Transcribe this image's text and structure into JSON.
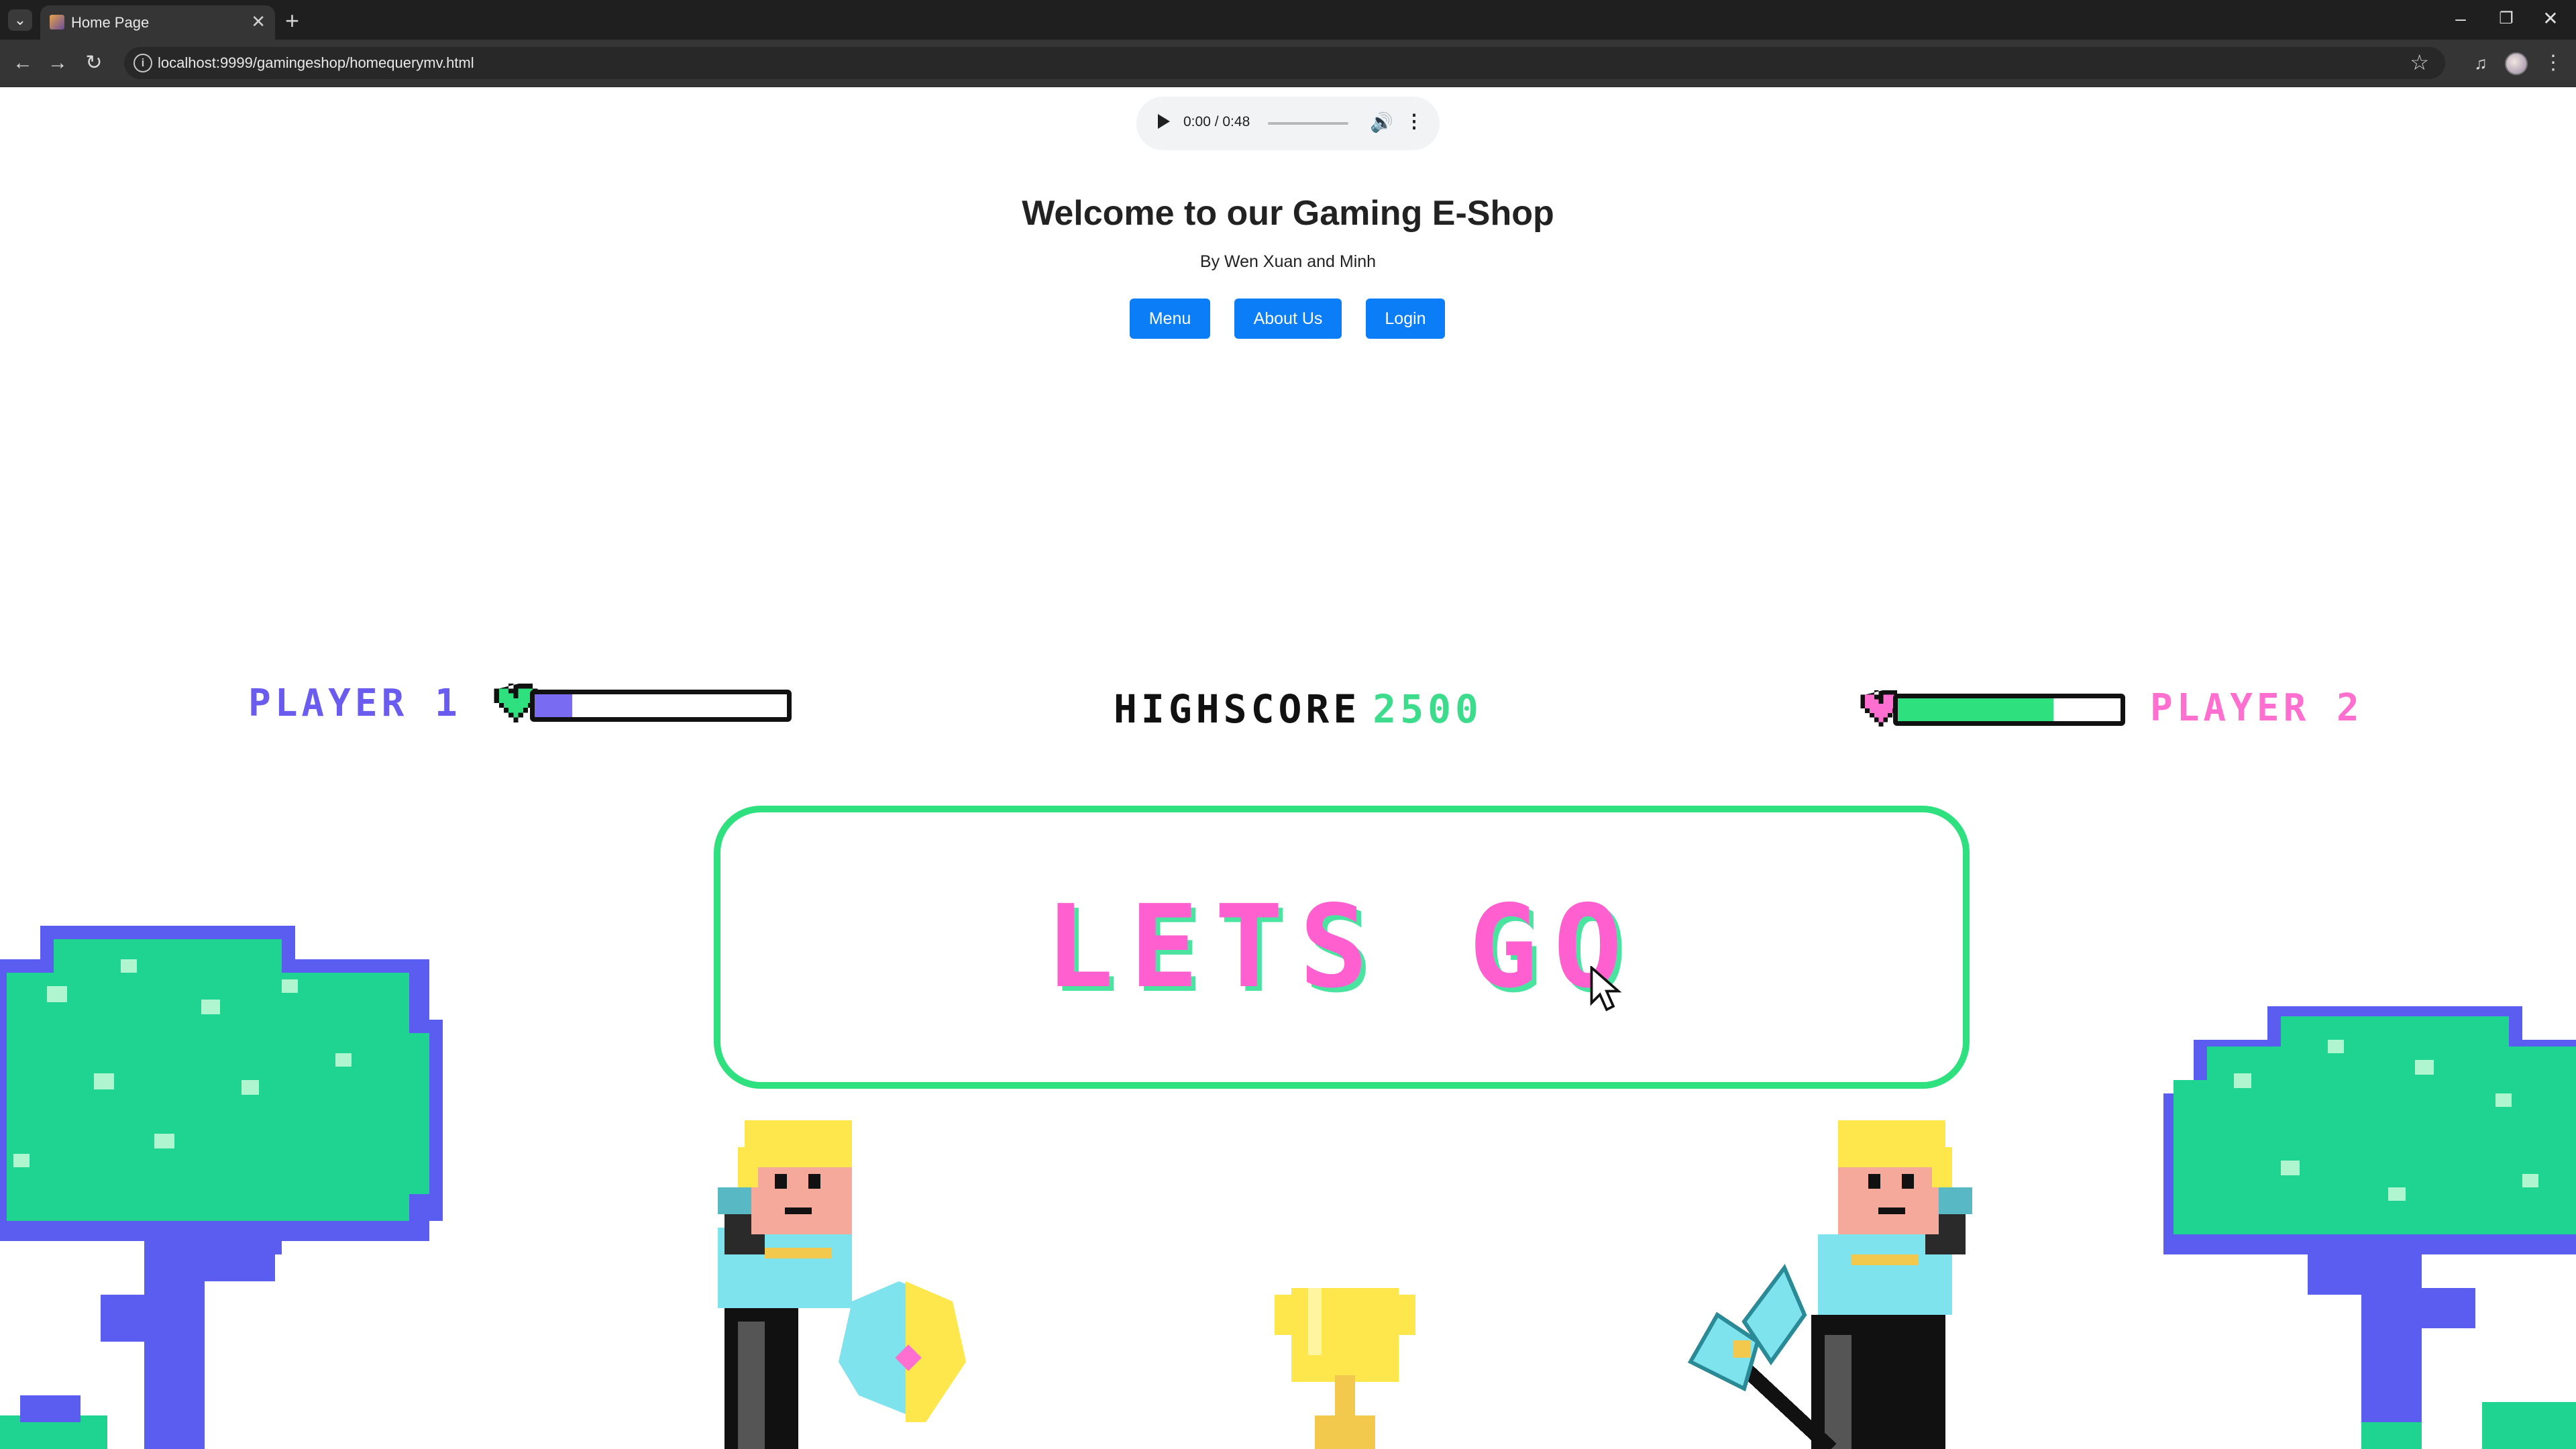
{
  "browser": {
    "tab_title": "Home Page",
    "url": "localhost:9999/gamingeshop/homequerymv.html",
    "icons": [
      "tab-search-icon",
      "favicon-icon",
      "close-icon",
      "plus-icon",
      "minimize-icon",
      "restore-icon",
      "close-window-icon",
      "back-icon",
      "forward-icon",
      "reload-icon",
      "site-info-icon",
      "star-icon",
      "media-control-icon",
      "profile-avatar-icon",
      "more-vert-icon"
    ]
  },
  "audio": {
    "time": "0:00 / 0:48"
  },
  "header": {
    "title": "Welcome to our Gaming E-Shop",
    "byline": "By Wen Xuan and Minh"
  },
  "nav": {
    "menu": "Menu",
    "about": "About Us",
    "login": "Login"
  },
  "game": {
    "player1_label": "PLAYER 1",
    "player2_label": "PLAYER 2",
    "highscore_label": "HIGHSCORE",
    "highscore_value": "2500",
    "player1_health": 0.15,
    "player2_health": 0.7,
    "cta": "LETS GO"
  },
  "colors": {
    "button": "#0a7df7",
    "player1": "#6b5cf0",
    "player2": "#ff6fcf",
    "accent_green": "#2ee07e",
    "trunk": "#5b5cf0",
    "leaves": "#1ed490",
    "trophy": "#fde74c"
  }
}
